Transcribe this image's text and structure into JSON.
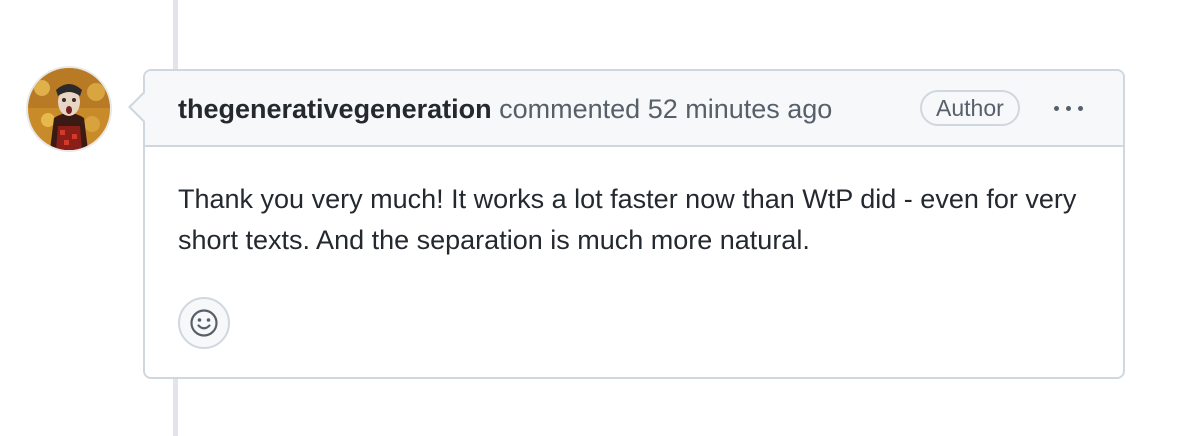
{
  "timeline": {
    "line_color": "#e1e4e8"
  },
  "comment": {
    "avatar_icon": "user-avatar",
    "author": "thegenerativegeneration",
    "action": "commented",
    "timestamp": "52 minutes ago",
    "badge": "Author",
    "menu_icon": "kebab-horizontal-icon",
    "body": "Thank you very much! It works a lot faster now than WtP did - even for very short texts. And the separation is much more natural.",
    "reaction_icon": "smiley-icon"
  },
  "colors": {
    "border": "#d0d7de",
    "header_bg": "#f6f8fa",
    "text": "#24292f",
    "muted": "#57606a"
  }
}
